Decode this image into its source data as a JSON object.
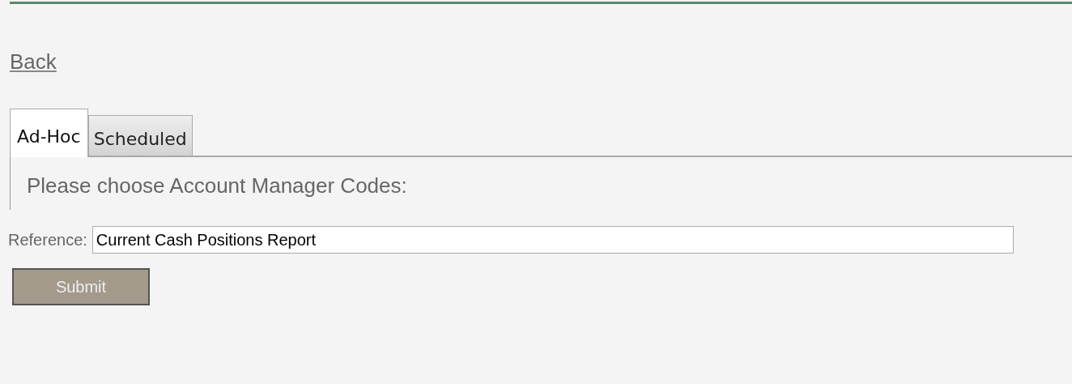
{
  "back_link": "Back",
  "tabs": [
    {
      "label": "Ad-Hoc",
      "selected": true
    },
    {
      "label": "Scheduled",
      "selected": false
    }
  ],
  "heading": "Please choose Account Manager Codes:",
  "reference": {
    "label": "Reference:",
    "value": "Current Cash Positions Report"
  },
  "submit_button": "Submit"
}
